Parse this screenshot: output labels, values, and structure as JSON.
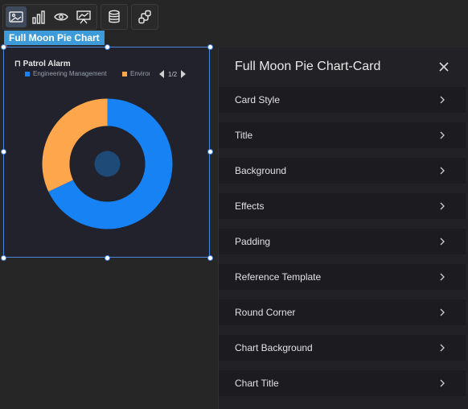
{
  "component_label": "Full Moon Pie Chart",
  "widget": {
    "title": "Patrol Alarm",
    "legend": [
      {
        "name": "Engineering Management",
        "color": "#1682f4"
      },
      {
        "name": "Environmental",
        "color": "#fda64b"
      }
    ],
    "pager": "1/2"
  },
  "chart_data": {
    "type": "pie",
    "title": "Patrol Alarm",
    "categories": [
      "Engineering Management",
      "Environmental"
    ],
    "values": [
      68,
      32
    ],
    "colors": [
      "#1682f4",
      "#fda64b"
    ],
    "inner_radius_ratio": 0.58,
    "legend_position": "top"
  },
  "panel": {
    "title": "Full Moon Pie Chart-Card",
    "rows": [
      {
        "label": "Card Style"
      },
      {
        "label": "Title"
      },
      {
        "label": "Background"
      },
      {
        "label": "Effects"
      },
      {
        "label": "Padding"
      },
      {
        "label": "Reference Template"
      },
      {
        "label": "Round Corner"
      },
      {
        "label": "Chart Background"
      },
      {
        "label": "Chart Title"
      }
    ]
  }
}
